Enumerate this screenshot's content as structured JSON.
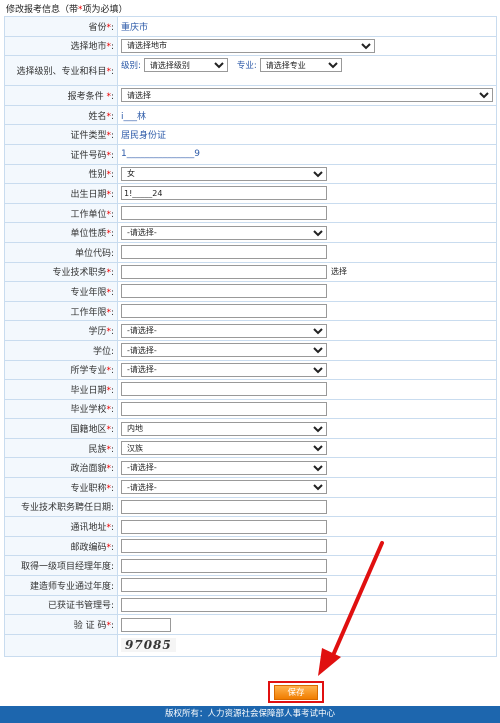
{
  "header": {
    "title": "修改报考信息（带",
    "star": "*",
    "title_suffix": "项为必填）"
  },
  "rows": {
    "province": {
      "label": "省份",
      "value": "重庆市"
    },
    "city": {
      "label": "选择地市",
      "value": "请选择地市"
    },
    "level": {
      "label": "选择级别、专业和科目",
      "level_label": "级别:",
      "level_value": "请选择级别",
      "major_label": "专业:",
      "major_value": "请选择专业"
    },
    "condition": {
      "label": "报考条件",
      "value": "请选择"
    },
    "name": {
      "label": "姓名",
      "value": "i___林"
    },
    "id_type": {
      "label": "证件类型",
      "value": "居民身份证"
    },
    "id_number": {
      "label": "证件号码",
      "value": "1_______________9"
    },
    "gender": {
      "label": "性别",
      "value": "女"
    },
    "birth": {
      "label": "出生日期",
      "value": "1!_____24"
    },
    "work_unit": {
      "label": "工作单位",
      "value": ""
    },
    "unit_nature": {
      "label": "单位性质",
      "value": "-请选择-"
    },
    "unit_code": {
      "label": "单位代码",
      "value": ""
    },
    "tech_position": {
      "label": "专业技术职务",
      "value": "",
      "link": "选择"
    },
    "major_years": {
      "label": "专业年限",
      "value": ""
    },
    "work_years": {
      "label": "工作年限",
      "value": ""
    },
    "education": {
      "label": "学历",
      "value": "-请选择-"
    },
    "degree": {
      "label": "学位",
      "value": "-请选择-"
    },
    "study_major": {
      "label": "所学专业",
      "value": "-请选择-"
    },
    "grad_date": {
      "label": "毕业日期",
      "value": ""
    },
    "school": {
      "label": "毕业学校",
      "value": ""
    },
    "country": {
      "label": "国籍地区",
      "value": "内地"
    },
    "ethnicity": {
      "label": "民族",
      "value": "汉族"
    },
    "politics": {
      "label": "政治面貌",
      "value": "-请选择-"
    },
    "title_rank": {
      "label": "专业职称",
      "value": "-请选择-"
    },
    "appoint_date": {
      "label": "专业技术职务聘任日期",
      "value": ""
    },
    "address": {
      "label": "通讯地址",
      "value": ""
    },
    "postcode": {
      "label": "邮政编码",
      "value": ""
    },
    "pm_year": {
      "label": "取得一级项目经理年度",
      "value": ""
    },
    "arch_year": {
      "label": "建造师专业通过年度",
      "value": ""
    },
    "cert_no": {
      "label": "已获证书管理号",
      "value": ""
    },
    "captcha": {
      "label": "验 证 码",
      "value": "",
      "image_text": "97085"
    }
  },
  "save_label": "保存",
  "footer": "版权所有：人力资源社会保障部人事考试中心",
  "colors": {
    "accent": "#f07d00",
    "footer": "#1d66ae",
    "highlight": "#e01010",
    "label_bg": "#f3f8fd",
    "link": "#2c5aa8"
  },
  "icons": {
    "annotation": "red-arrow-icon"
  }
}
